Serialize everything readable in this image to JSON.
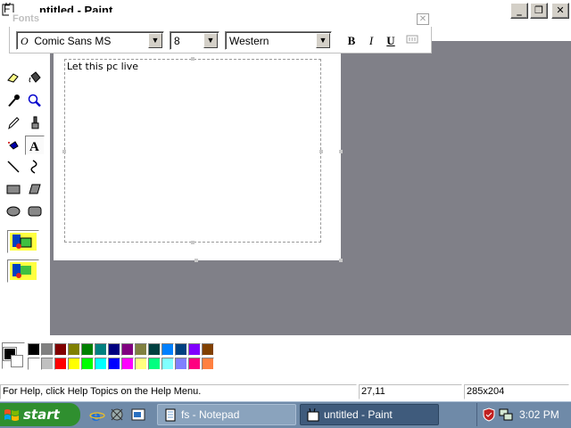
{
  "window": {
    "title": "untitled - Paint",
    "title_visible": "ntitled - Paint",
    "buttons": {
      "minimize": "_",
      "maximize": "❐",
      "close": "✕"
    }
  },
  "menu": {
    "first_visible": "F"
  },
  "fonts_toolbar": {
    "title": "Fonts",
    "font_name": "Comic Sans MS",
    "font_size": "8",
    "script": "Western",
    "bold_label": "B",
    "italic_label": "I",
    "underline_label": "U"
  },
  "canvas": {
    "text": "Let this pc live"
  },
  "palette": {
    "foreground": "#000000",
    "background": "#ffffff",
    "top_row": [
      "#000000",
      "#808080",
      "#800000",
      "#808000",
      "#008000",
      "#008080",
      "#000080",
      "#800080",
      "#808040",
      "#004040",
      "#0080ff",
      "#004080",
      "#8000ff",
      "#804000"
    ],
    "bottom_row": [
      "#ffffff",
      "#c0c0c0",
      "#ff0000",
      "#ffff00",
      "#00ff00",
      "#00ffff",
      "#0000ff",
      "#ff00ff",
      "#ffff80",
      "#00ff80",
      "#80ffff",
      "#8080ff",
      "#ff0080",
      "#ff8040"
    ]
  },
  "status": {
    "help": "For Help, click Help Topics on the Help Menu.",
    "coords": "27,11",
    "size": "285x204"
  },
  "taskbar": {
    "start_label": "start",
    "tasks": [
      {
        "label": "fs - Notepad",
        "active": false
      },
      {
        "label": "untitled - Paint",
        "active": true
      }
    ],
    "clock": "3:02 PM"
  }
}
